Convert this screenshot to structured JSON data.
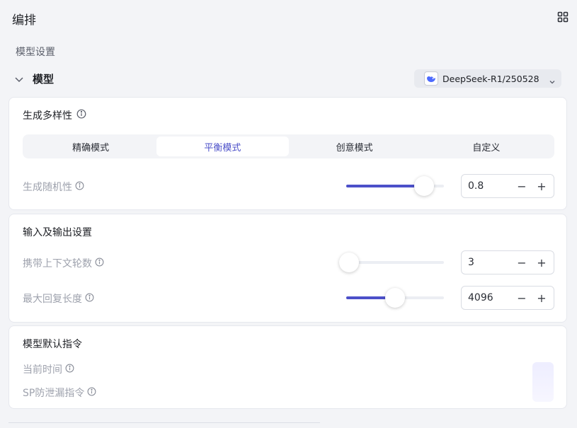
{
  "header": {
    "title": "编排"
  },
  "section_label": "模型设置",
  "model": {
    "label": "模型",
    "selected": "DeepSeek-R1/250528"
  },
  "diversity": {
    "title": "生成多样性",
    "modes": [
      "精确模式",
      "平衡模式",
      "创意模式",
      "自定义"
    ],
    "active_mode": "平衡模式",
    "randomness": {
      "label": "生成随机性",
      "value": "0.8",
      "fraction": 0.8
    }
  },
  "io": {
    "title": "输入及输出设置",
    "context_rounds": {
      "label": "携带上下文轮数",
      "value": "3",
      "fraction": 0.03
    },
    "max_length": {
      "label": "最大回复长度",
      "value": "4096",
      "fraction": 0.5
    }
  },
  "defaults": {
    "title": "模型默认指令",
    "items": [
      "当前时间",
      "SP防泄漏指令"
    ]
  },
  "colors": {
    "accent": "#4c50c9",
    "background": "#f3f4f7"
  }
}
